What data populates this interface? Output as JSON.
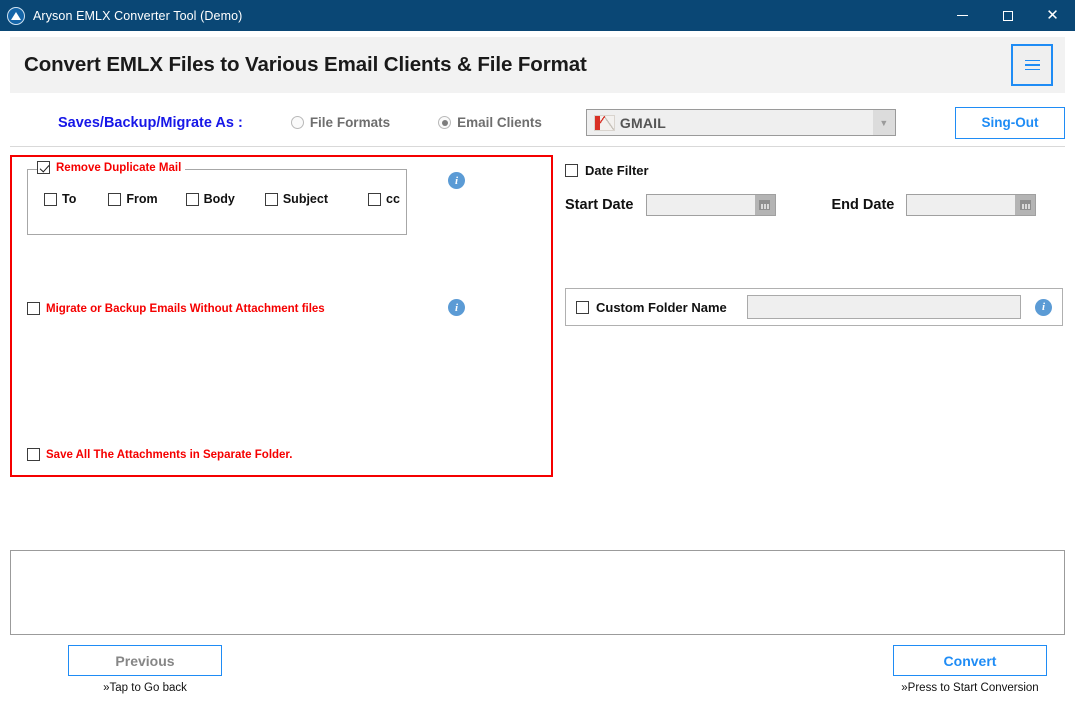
{
  "window": {
    "title": "Aryson EMLX Converter Tool (Demo)",
    "logo_icon": "aryson-logo-icon",
    "controls": {
      "minimize": "minimize-icon",
      "maximize": "maximize-icon",
      "close": "close-icon"
    }
  },
  "header": {
    "title": "Convert EMLX Files to Various Email Clients & File Format",
    "menu_icon": "hamburger-menu-icon"
  },
  "options": {
    "save_as_label": "Saves/Backup/Migrate As :",
    "radios": [
      {
        "label": "File Formats",
        "selected": false
      },
      {
        "label": "Email Clients",
        "selected": true
      }
    ],
    "client_select": {
      "value": "GMAIL",
      "icon": "gmail-logo-icon",
      "arrow_icon": "chevron-down-icon"
    },
    "signout_label": "Sing-Out"
  },
  "left_panel": {
    "remove_duplicate": {
      "label": "Remove Duplicate Mail",
      "checked": true,
      "info_icon": "info-icon",
      "sub_options": [
        {
          "label": "To",
          "checked": false
        },
        {
          "label": "From",
          "checked": false
        },
        {
          "label": "Body",
          "checked": false
        },
        {
          "label": "Subject",
          "checked": false
        },
        {
          "label": "cc",
          "checked": false
        }
      ]
    },
    "migrate_without_attachment": {
      "label": "Migrate or Backup Emails Without Attachment files",
      "checked": false,
      "info_icon": "info-icon"
    },
    "save_attachments_separate": {
      "label": "Save All The Attachments in Separate Folder.",
      "checked": false
    }
  },
  "right_panel": {
    "date_filter": {
      "label": "Date Filter",
      "checked": false,
      "start_date_label": "Start Date",
      "start_date_value": "",
      "end_date_label": "End Date",
      "end_date_value": "",
      "calendar_icon": "calendar-icon"
    },
    "custom_folder": {
      "label": "Custom Folder Name",
      "checked": false,
      "value": "",
      "placeholder": "",
      "info_icon": "info-icon"
    }
  },
  "log_panel": {
    "content": ""
  },
  "footer": {
    "previous": {
      "label": "Previous",
      "hint": "»Tap to Go back"
    },
    "convert": {
      "label": "Convert",
      "hint": "»Press to Start Conversion"
    }
  },
  "colors": {
    "titlebar": "#0a4775",
    "accent_blue": "#1f8cf5",
    "alert_red": "#f50000",
    "label_blue": "#1717e8"
  }
}
